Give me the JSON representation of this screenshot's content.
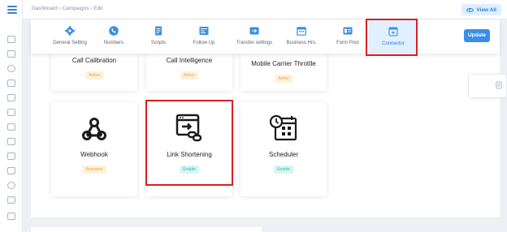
{
  "breadcrumb": "Dashboard  ›  Campaigns  ›  Edit",
  "view_all": "View All",
  "update_label": "Update",
  "tabs": [
    {
      "label": "General Setting",
      "icon": "gear-icon"
    },
    {
      "label": "Numbers",
      "icon": "phone-icon"
    },
    {
      "label": "Scripts",
      "icon": "scripts-icon"
    },
    {
      "label": "Follow Up",
      "icon": "follow-up-icon"
    },
    {
      "label": "Transfer settings",
      "icon": "transfer-icon"
    },
    {
      "label": "Business Hrs.",
      "icon": "calendar-icon"
    },
    {
      "label": "Form Post",
      "icon": "form-post-icon"
    },
    {
      "label": "Connector",
      "icon": "connector-icon"
    }
  ],
  "active_tab": "Connector",
  "connectors": [
    {
      "name": "Call Calibration",
      "status": "Active",
      "status_color": "#e9a23b"
    },
    {
      "name": "Call Intelligence",
      "status": "Active",
      "status_color": "#e9a23b"
    },
    {
      "name": "Mobile Carrier Throttle",
      "status": "Active",
      "status_color": "#e9a23b"
    },
    {
      "name": "Webhook",
      "status": "Activated",
      "status_color": "#e9a23b",
      "icon": "webhook-icon"
    },
    {
      "name": "Link Shortening",
      "status": "Enable",
      "status_color": "#2fb8a8",
      "icon": "link-shortening-icon"
    },
    {
      "name": "Scheduler",
      "status": "Enable",
      "status_color": "#2fb8a8",
      "icon": "scheduler-icon"
    }
  ],
  "colors": {
    "accent": "#3a8ee6",
    "highlight": "#d81f26",
    "active_tab_bg": "#e1f0ff"
  }
}
